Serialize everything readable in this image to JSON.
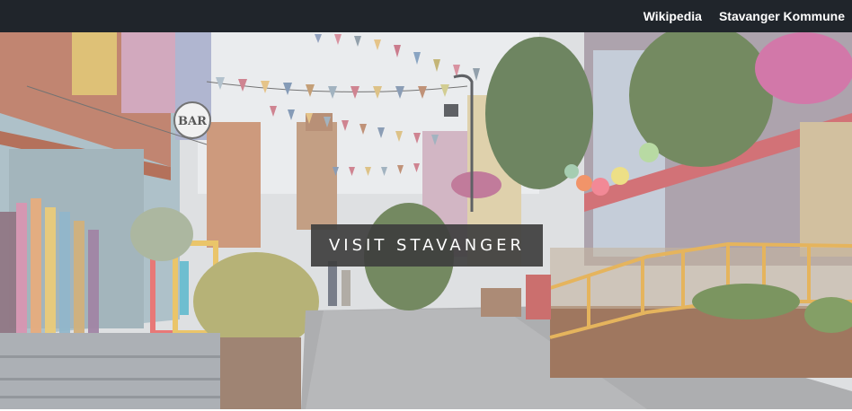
{
  "navbar": {
    "links": [
      "Wikipedia",
      "Stavanger Kommune"
    ]
  },
  "hero": {
    "title": "VISIT STAVANGER",
    "sign_text": "BAR",
    "colors": {
      "navbar": "#20252b",
      "title_box": "#3e3e3e",
      "rail": "#e0a43a",
      "planter": "#8a5a3c"
    }
  }
}
